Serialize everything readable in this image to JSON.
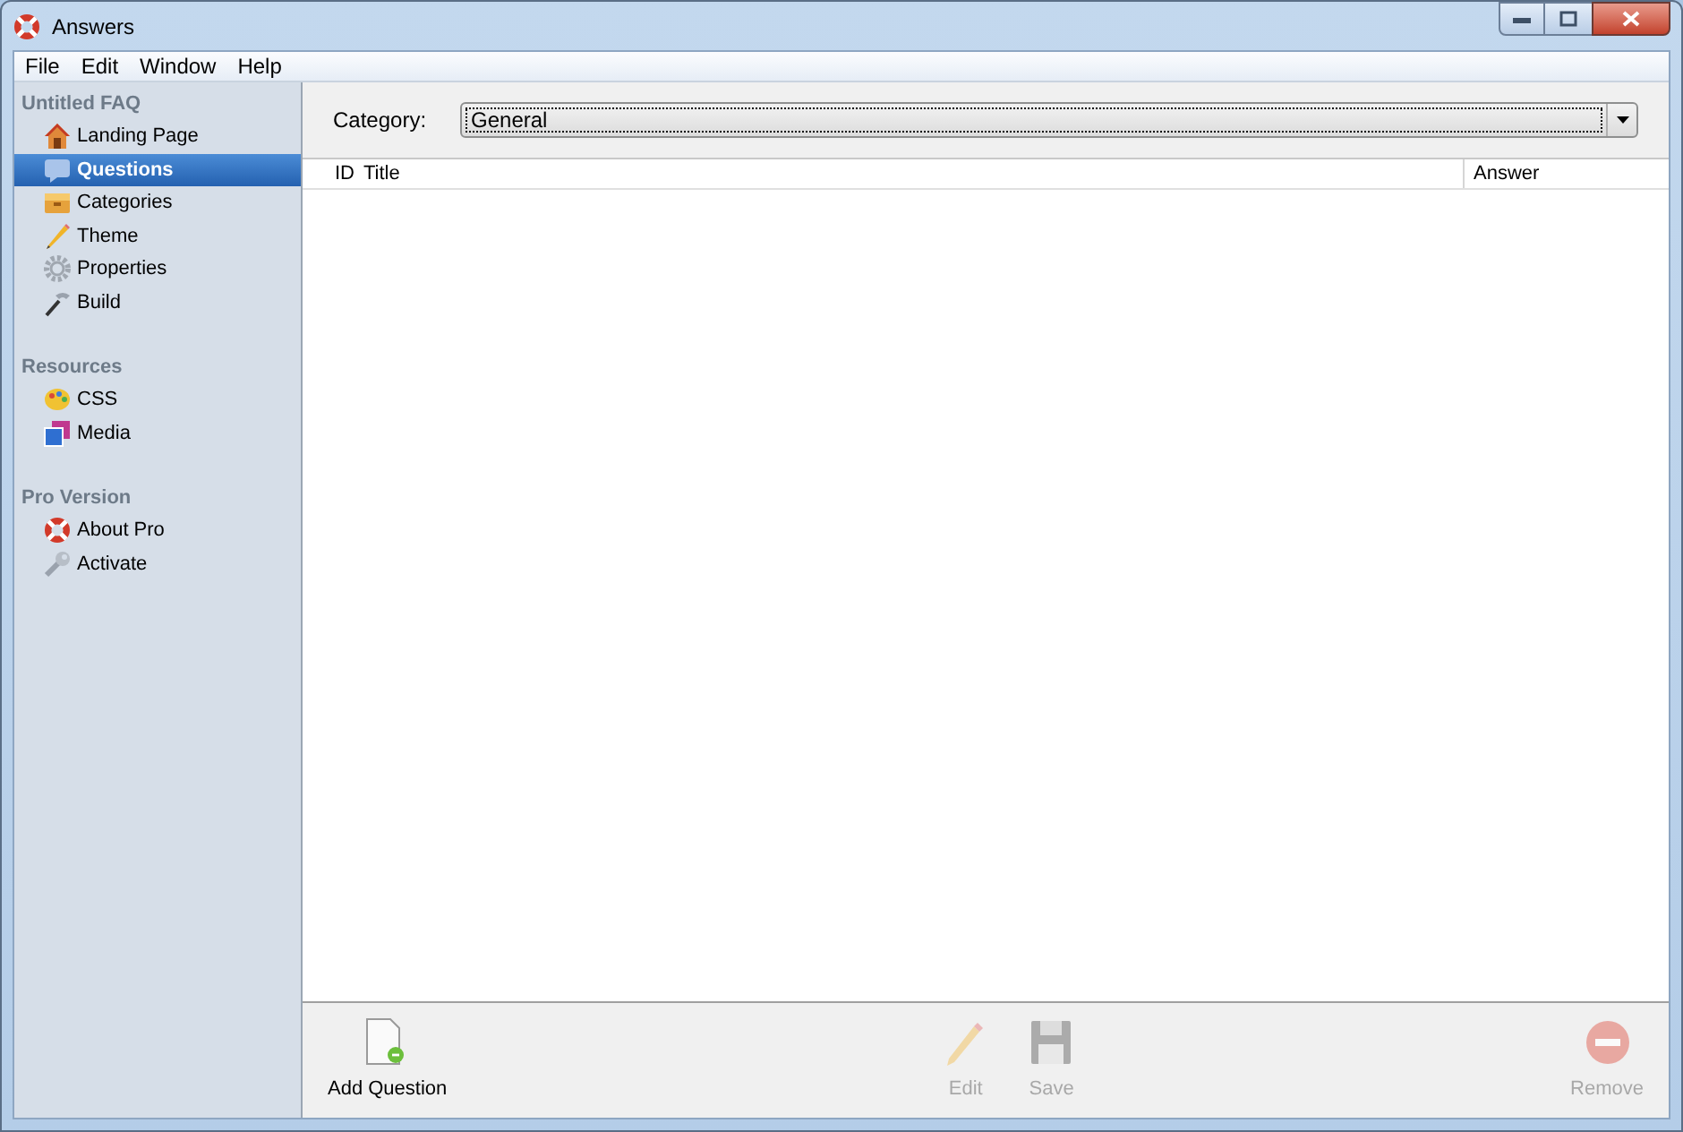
{
  "window": {
    "title": "Answers"
  },
  "menu": [
    "File",
    "Edit",
    "Window",
    "Help"
  ],
  "sidebar": {
    "sections": [
      {
        "title": "Untitled FAQ",
        "items": [
          {
            "label": "Landing Page",
            "selected": false
          },
          {
            "label": "Questions",
            "selected": true
          },
          {
            "label": "Categories",
            "selected": false
          },
          {
            "label": "Theme",
            "selected": false
          },
          {
            "label": "Properties",
            "selected": false
          },
          {
            "label": "Build",
            "selected": false
          }
        ]
      },
      {
        "title": "Resources",
        "items": [
          {
            "label": "CSS",
            "selected": false
          },
          {
            "label": "Media",
            "selected": false
          }
        ]
      },
      {
        "title": "Pro Version",
        "items": [
          {
            "label": "About Pro",
            "selected": false
          },
          {
            "label": "Activate",
            "selected": false
          }
        ]
      }
    ]
  },
  "category": {
    "label": "Category:",
    "value": "General"
  },
  "table": {
    "columns": [
      "ID",
      "Title",
      "Answer"
    ]
  },
  "toolbar": [
    {
      "label": "Add Question",
      "disabled": false
    },
    {
      "label": "Edit",
      "disabled": true
    },
    {
      "label": "Save",
      "disabled": true
    },
    {
      "label": "Remove",
      "disabled": true
    }
  ]
}
